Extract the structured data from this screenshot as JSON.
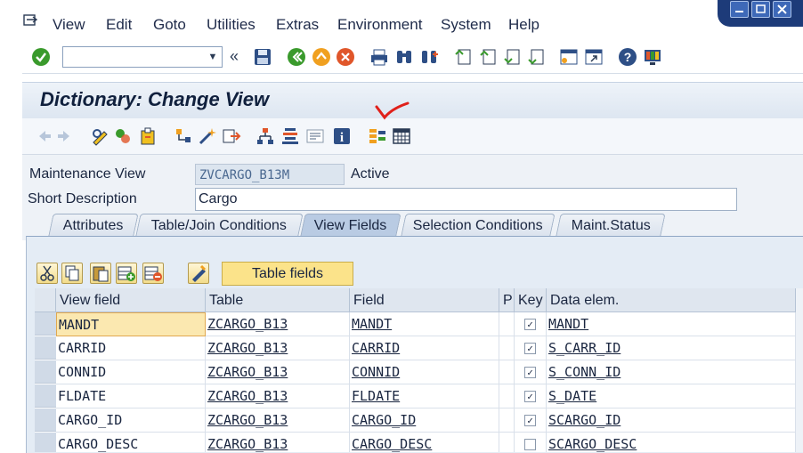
{
  "menu": {
    "items": [
      "View",
      "Edit",
      "Goto",
      "Utilities",
      "Extras",
      "Environment",
      "System",
      "Help"
    ],
    "underline": [
      "V",
      "E",
      "G",
      "U",
      "x",
      "n",
      "S",
      "H"
    ]
  },
  "title": "Dictionary: Change View",
  "header": {
    "maint_view_label": "Maintenance View",
    "maint_view_value": "ZVCARGO_B13M",
    "status": "Active",
    "short_desc_label": "Short Description",
    "short_desc_value": "Cargo"
  },
  "tabs": [
    {
      "label": "Attributes",
      "active": false
    },
    {
      "label": "Table/Join Conditions",
      "active": false
    },
    {
      "label": "View Fields",
      "active": true
    },
    {
      "label": "Selection Conditions",
      "active": false
    },
    {
      "label": "Maint.Status",
      "active": false
    }
  ],
  "table_fields_button": "Table fields",
  "grid": {
    "columns": [
      "View field",
      "Table",
      "Field",
      "P",
      "Key",
      "Data elem."
    ],
    "rows": [
      {
        "view_field": "MANDT",
        "table": "ZCARGO_B13",
        "field": "MANDT",
        "p": "",
        "key": true,
        "data_elem": "MANDT"
      },
      {
        "view_field": "CARRID",
        "table": "ZCARGO_B13",
        "field": "CARRID",
        "p": "",
        "key": true,
        "data_elem": "S_CARR_ID"
      },
      {
        "view_field": "CONNID",
        "table": "ZCARGO_B13",
        "field": "CONNID",
        "p": "",
        "key": true,
        "data_elem": "S_CONN_ID"
      },
      {
        "view_field": "FLDATE",
        "table": "ZCARGO_B13",
        "field": "FLDATE",
        "p": "",
        "key": true,
        "data_elem": "S_DATE"
      },
      {
        "view_field": "CARGO_ID",
        "table": "ZCARGO_B13",
        "field": "CARGO_ID",
        "p": "",
        "key": true,
        "data_elem": "SCARGO_ID"
      },
      {
        "view_field": "CARGO_DESC",
        "table": "ZCARGO_B13",
        "field": "CARGO_DESC",
        "p": "",
        "key": false,
        "data_elem": "SCARGO_DESC"
      }
    ]
  },
  "colors": {
    "title_bg": "#dde6f1",
    "tab_active": "#b9cbe3",
    "table_fields_btn": "#fbe38a",
    "focus_cell": "#fbe8b0",
    "annotation": "#e0201a"
  }
}
